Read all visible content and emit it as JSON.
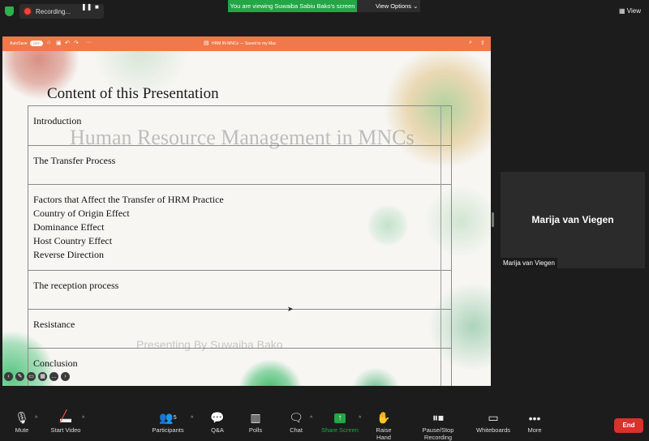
{
  "topbar": {
    "recording_label": "Recording...",
    "pause_glyph": "❚❚",
    "stop_glyph": "■",
    "viewing_banner": "You are viewing Suwaiba Sabiu Bako's screen",
    "view_options": "View Options",
    "view_button": "View"
  },
  "ppt": {
    "autosave": "AutoSave",
    "autosave_state": "OFF",
    "doc_title": "HRM IN MNCs — Saved to my Mac"
  },
  "slide": {
    "title": "Content of this Presentation",
    "watermark": "Human Resource Management in MNCs",
    "presenting": "Presenting By Suwaiba Bako",
    "rows": [
      [
        "Introduction"
      ],
      [
        "The Transfer Process"
      ],
      [
        "Factors that Affect the Transfer of HRM Practice",
        "Country of Origin Effect",
        "Dominance Effect",
        "Host Country Effect",
        "Reverse Direction"
      ],
      [
        "The reception process"
      ],
      [
        "Resistance"
      ],
      [
        "Conclusion"
      ]
    ]
  },
  "participant_tile": {
    "name": "Marija van Viegen",
    "label": "Marija van Viegen"
  },
  "toolbar": {
    "mute": "Mute",
    "start_video": "Start Video",
    "participants": "Participants",
    "participants_count": "5",
    "qa": "Q&A",
    "polls": "Polls",
    "chat": "Chat",
    "share_screen": "Share Screen",
    "raise_hand": "Raise Hand",
    "pause_stop_recording": "Pause/Stop Recording",
    "whiteboards": "Whiteboards",
    "more": "More",
    "end": "End"
  },
  "colors": {
    "zoom_green": "#23a646",
    "ppt_orange": "#f0784a",
    "end_red": "#d9322b"
  }
}
